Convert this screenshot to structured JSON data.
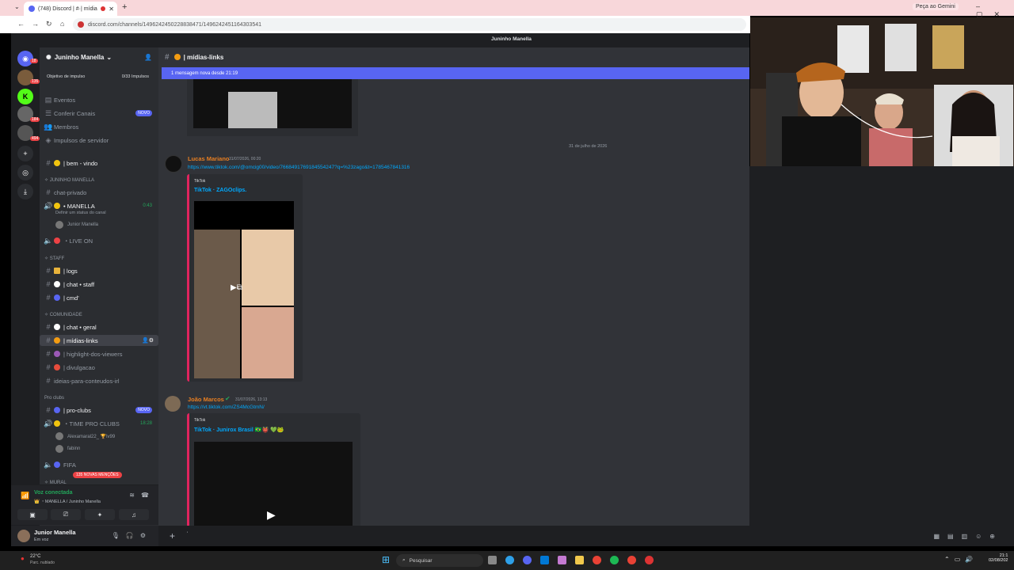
{
  "browser": {
    "tab_title": "(748) Discord | #·| mídia",
    "gemini_label": "Peça ao Gemini",
    "url": "discord.com/channels/1496242450228838471/1496242451164303541"
  },
  "top_strip_title": "Juninho Manella",
  "server_rail": {
    "badges": [
      "18",
      "135",
      "184",
      "494"
    ]
  },
  "guild": {
    "name": "Juninho Manella",
    "boost_label": "Objetivo de impulso",
    "boost_count": "0/33 Impulsos",
    "menu": [
      {
        "label": "Eventos",
        "icon": "calendar-icon"
      },
      {
        "label": "Conferir Canais",
        "icon": "compass-icon",
        "badge": "NOVO"
      },
      {
        "label": "Membros",
        "icon": "members-icon"
      },
      {
        "label": "Impulsos de servidor",
        "icon": "boost-icon"
      }
    ],
    "channels": {
      "bem_vindo": "| bem - vindo",
      "cat_juninho": "✧ JUNINHO MANELLA",
      "chat_privado": "chat-privado",
      "voice_manella": "• MANELLA",
      "voice_manella_timer": "0:43",
      "voice_manella_status": "Definir um status do canal",
      "voice_member": "Junior Manella",
      "live_on": "・LIVE ON",
      "cat_staff": "✧ STAFF",
      "logs": "| logs",
      "chat_staff": "| chat • staff",
      "cmd": "| cmd'",
      "cat_comunidade": "✧ COMUNIDADE",
      "chat_geral": "| chat • geral",
      "midias_links": "| mídias-links",
      "highlight": "| highlight-dos-viewers",
      "divulgacao": "| divulgacao",
      "ideias": "ideias-para-conteudos-irl",
      "cat_proclubs": "Pro clubs",
      "pro_clubs": "| pro-clubs",
      "pro_clubs_badge": "NOVO",
      "time_pro_clubs": "・TIME PRO CLUBS",
      "time_pro_clubs_timer": "18:28",
      "member_alexa": "Alexamaral22_ 🏆lv99",
      "member_fabinn": "fabinn",
      "fifa": "FIFA",
      "mentions_badge": "135 NOVAS MENÇÕES",
      "mural": "✧ MURAL"
    }
  },
  "voice_panel": {
    "title": "Voz conectada",
    "subtitle": "👑 ・MANELLA / Juninho Manella"
  },
  "user_panel": {
    "name": "Junior Manella",
    "status": "Em voz"
  },
  "channel_header": {
    "name": "| mídias-links"
  },
  "new_messages_bar": "1 mensagem nova desde 21:19",
  "date_divider": "31 de julho de 2026",
  "messages": [
    {
      "author": "Lucas Mariano",
      "author_color": "#e67e22",
      "timestamp": "31/07/2026, 00:20",
      "link": "https://www.tiktok.com/@omcig00/video/7668491769184554247?q=%23zago&t=1785467841316",
      "embed_provider": "TikTok",
      "embed_title": "TikTok · ZAGOclips."
    },
    {
      "author": "João Marcos",
      "author_color": "#e67e22",
      "timestamp": "31/07/2026, 13:13",
      "link": "https://vt.tiktok.com/ZS4McGtmN/",
      "embed_provider": "TikTok",
      "embed_title": "TikTok · Junirox Brasil 🇧🇷👹 💚🐸"
    }
  ],
  "taskbar": {
    "weather_temp": "22°C",
    "weather_desc": "Parc. nublado",
    "search_placeholder": "Pesquisar",
    "time": "21:1",
    "date": "02/08/202"
  },
  "colors": {
    "accent": "#5865f2",
    "online": "#23a55a",
    "danger": "#ed4245",
    "link": "#00a8fc"
  }
}
